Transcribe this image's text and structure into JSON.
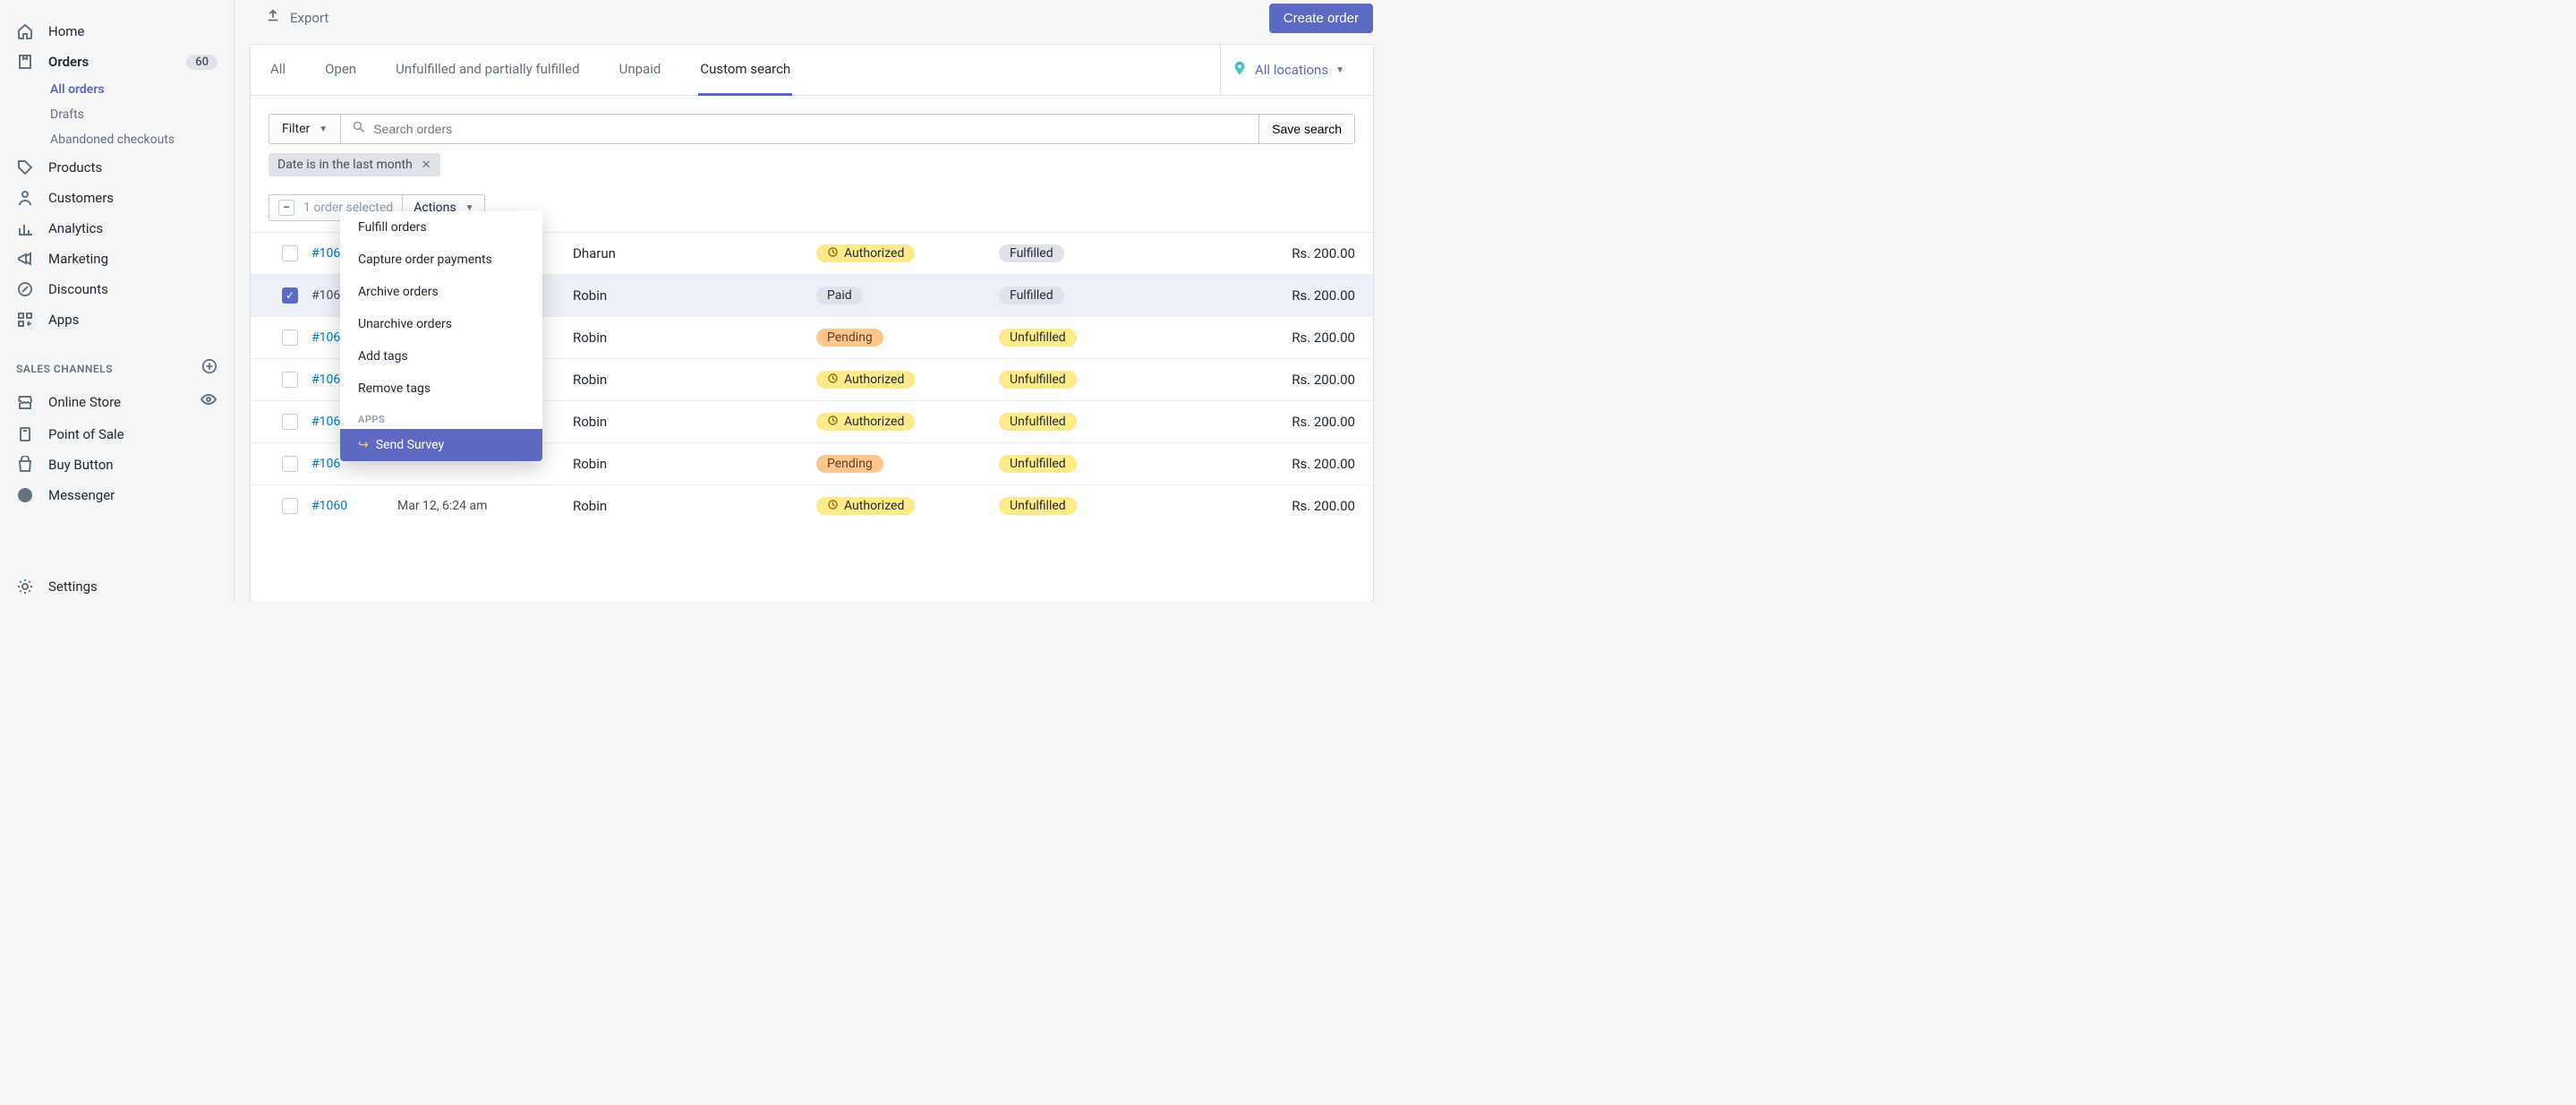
{
  "sidebar": {
    "nav": {
      "home": "Home",
      "orders": "Orders",
      "orders_badge": "60",
      "all_orders": "All orders",
      "drafts": "Drafts",
      "abandoned": "Abandoned checkouts",
      "products": "Products",
      "customers": "Customers",
      "analytics": "Analytics",
      "marketing": "Marketing",
      "discounts": "Discounts",
      "apps": "Apps"
    },
    "channels_header": "SALES CHANNELS",
    "channels": {
      "online_store": "Online Store",
      "pos": "Point of Sale",
      "buy_button": "Buy Button",
      "messenger": "Messenger"
    },
    "settings": "Settings"
  },
  "topbar": {
    "export": "Export",
    "create": "Create order"
  },
  "tabs": {
    "all": "All",
    "open": "Open",
    "unfulfilled": "Unfulfilled and partially fulfilled",
    "unpaid": "Unpaid",
    "custom": "Custom search"
  },
  "locations": "All locations",
  "filterbar": {
    "filter": "Filter",
    "search_placeholder": "Search orders",
    "save_search": "Save search",
    "token": "Date is in the last month"
  },
  "bulk": {
    "selected_text": "1 order selected",
    "actions": "Actions"
  },
  "actions_menu": {
    "fulfill": "Fulfill orders",
    "capture": "Capture order payments",
    "archive": "Archive orders",
    "unarchive": "Unarchive orders",
    "add_tags": "Add tags",
    "remove_tags": "Remove tags",
    "apps_header": "APPS",
    "send_survey": "Send Survey"
  },
  "badge_labels": {
    "authorized": "Authorized",
    "paid": "Paid",
    "pending": "Pending",
    "fulfilled": "Fulfilled",
    "unfulfilled": "Unfulfilled"
  },
  "orders": [
    {
      "id": "#106",
      "date": "",
      "customer": "Dharun",
      "payment": "authorized",
      "fulfillment": "fulfilled",
      "total": "Rs. 200.00",
      "checked": false
    },
    {
      "id": "#106",
      "date": "",
      "customer": "Robin",
      "payment": "paid",
      "fulfillment": "fulfilled",
      "total": "Rs. 200.00",
      "checked": true
    },
    {
      "id": "#106",
      "date": "",
      "customer": "Robin",
      "payment": "pending",
      "fulfillment": "unfulfilled",
      "total": "Rs. 200.00",
      "checked": false
    },
    {
      "id": "#106",
      "date": "",
      "customer": "Robin",
      "payment": "authorized",
      "fulfillment": "unfulfilled",
      "total": "Rs. 200.00",
      "checked": false
    },
    {
      "id": "#106",
      "date": "",
      "customer": "Robin",
      "payment": "authorized",
      "fulfillment": "unfulfilled",
      "total": "Rs. 200.00",
      "checked": false
    },
    {
      "id": "#106",
      "date": "",
      "customer": "Robin",
      "payment": "pending",
      "fulfillment": "unfulfilled",
      "total": "Rs. 200.00",
      "checked": false
    },
    {
      "id": "#1060",
      "date": "Mar 12, 6:24 am",
      "customer": "Robin",
      "payment": "authorized",
      "fulfillment": "unfulfilled",
      "total": "Rs. 200.00",
      "checked": false
    }
  ]
}
